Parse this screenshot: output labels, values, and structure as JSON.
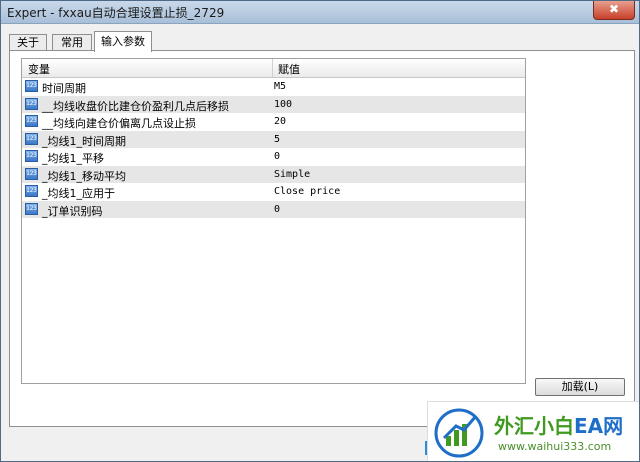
{
  "window": {
    "title": "Expert - fxxau自动合理设置止损_2729",
    "close_label": "✖"
  },
  "tabs": [
    {
      "label": "关于"
    },
    {
      "label": "常用"
    },
    {
      "label": "输入参数"
    }
  ],
  "grid": {
    "col_variable": "变量",
    "col_value": "赋值",
    "rows": [
      {
        "name": "时间周期",
        "value": "M5"
      },
      {
        "name": "__均线收盘价比建仓价盈利几点后移损",
        "value": "100"
      },
      {
        "name": "__均线向建仓价偏离几点设止损",
        "value": "20"
      },
      {
        "name": "_均线1_时间周期",
        "value": "5"
      },
      {
        "name": "_均线1_平移",
        "value": "0"
      },
      {
        "name": "_均线1_移动平均",
        "value": "Simple"
      },
      {
        "name": "_均线1_应用于",
        "value": "Close price"
      },
      {
        "name": "_订单识别码",
        "value": "0"
      }
    ],
    "icon_label": "123"
  },
  "buttons": {
    "load": "加载(L)"
  },
  "watermark": {
    "brand_part1": "外汇小白",
    "brand_part2": "EA网",
    "url": "www.waihui333.com",
    "color_green": "#3f9a1f",
    "color_blue": "#1f6fc8"
  }
}
